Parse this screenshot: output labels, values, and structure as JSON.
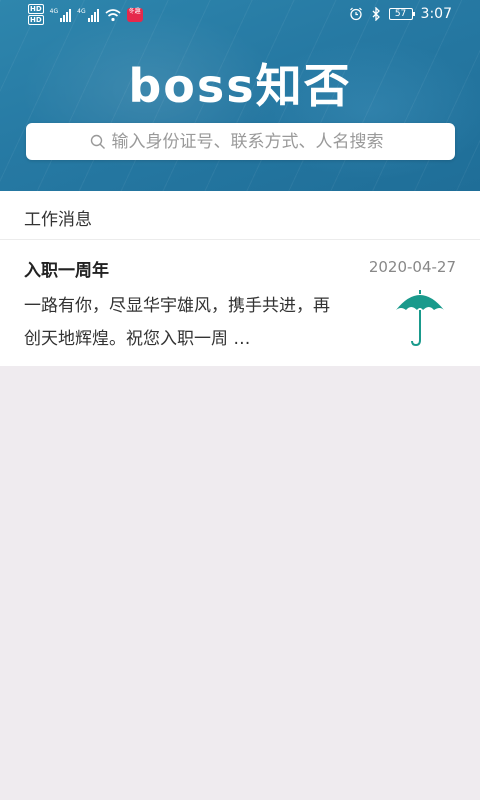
{
  "status_bar": {
    "hd_top": "HD",
    "hd_bottom": "HD",
    "sig1_label": "4G",
    "sig2_label": "4G",
    "notif_badge": "冬趣",
    "battery": "57",
    "time": "3:07"
  },
  "header": {
    "logo": "boss知否",
    "search_placeholder": "输入身份证号、联系方式、人名搜索"
  },
  "section": {
    "title": "工作消息"
  },
  "messages": [
    {
      "title": "入职一周年",
      "date": "2020-04-27",
      "body": "一路有你，尽显华宇雄风，携手共进，再创天地辉煌。祝您入职一周 …"
    }
  ],
  "colors": {
    "header_bg": "#2679a3",
    "page_bg": "#efebef",
    "umbrella": "#1a9a8c"
  }
}
